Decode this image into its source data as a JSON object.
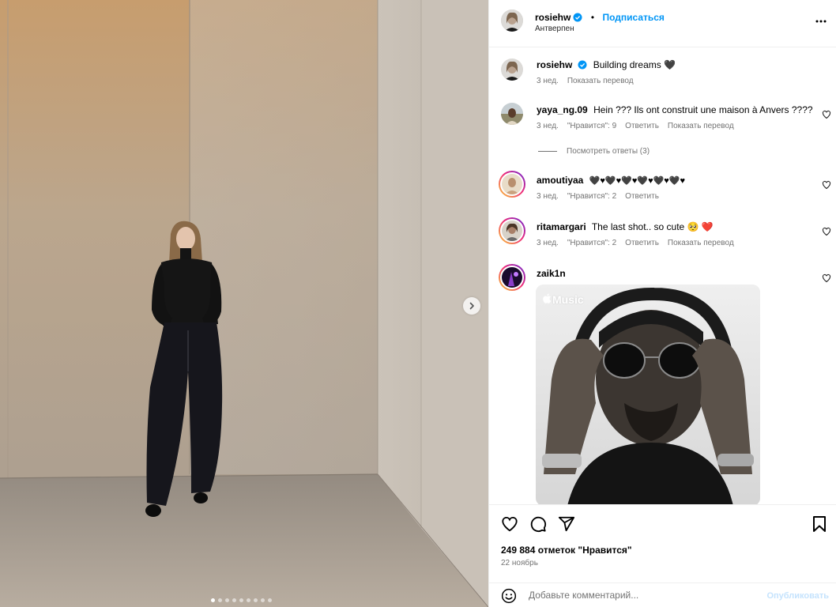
{
  "post": {
    "author": "rosiehw",
    "follow_label": "Подписаться",
    "location": "Антверпен",
    "caption": {
      "username": "rosiehw",
      "text": "Building dreams 🖤",
      "time": "3 нед.",
      "translate": "Показать перевод"
    },
    "carousel": {
      "dot_count": 9,
      "active_index": 0
    }
  },
  "comments": [
    {
      "username": "yaya_ng.09",
      "text": "Hein ??? Ils ont construit une maison à Anvers ????",
      "time": "3 нед.",
      "likes": "\"Нравится\": 9",
      "reply": "Ответить",
      "translate": "Показать перевод",
      "view_replies": "Посмотреть ответы (3)"
    },
    {
      "username": "amoutiyaa",
      "text": "🖤♥🖤♥🖤♥🖤♥🖤♥🖤♥",
      "time": "3 нед.",
      "likes": "\"Нравится\": 2",
      "reply": "Ответить"
    },
    {
      "username": "ritamargari",
      "text": "The last shot.. so cute 🥺 ❤️",
      "time": "3 нед.",
      "likes": "\"Нравится\": 2",
      "reply": "Ответить",
      "translate": "Показать перевод"
    },
    {
      "username": "zaik1n",
      "attachment_label": "Music"
    }
  ],
  "actions": {
    "likes_text": "249 884 отметок \"Нравится\"",
    "date": "22 ноябрь"
  },
  "composer": {
    "placeholder": "Добавьте комментарий...",
    "publish_label": "Опубликовать"
  },
  "colors": {
    "accent": "#0095f6",
    "muted_text": "#737373",
    "publish_disabled": "#c5e3fd",
    "divider": "#efefef"
  },
  "icons": [
    "chevron-right-icon",
    "verified-badge-icon",
    "more-options-icon",
    "heart-icon",
    "comment-icon",
    "share-icon",
    "bookmark-icon",
    "emoji-icon",
    "apple-logo-icon"
  ]
}
